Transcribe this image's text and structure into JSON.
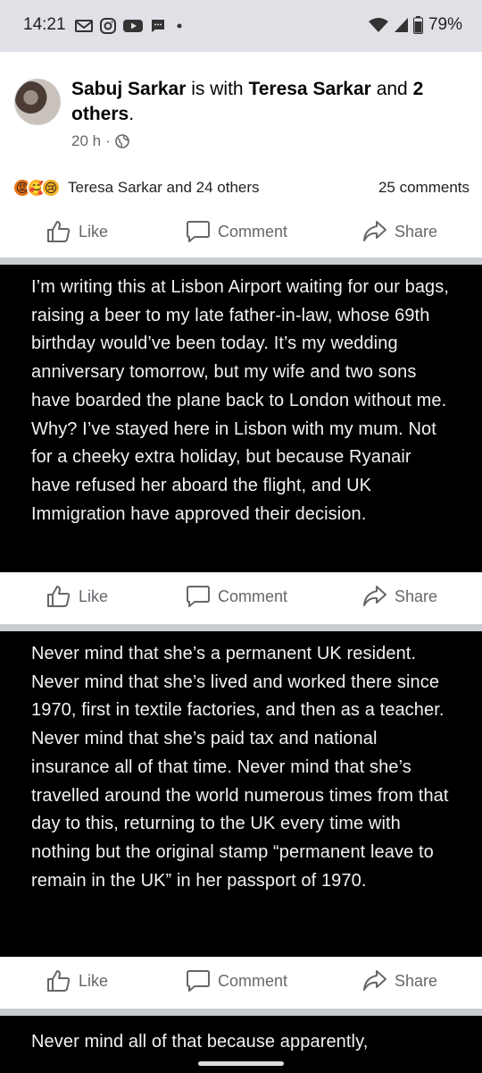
{
  "status_bar": {
    "time": "14:21",
    "left_icons": [
      "gmail-icon",
      "instagram-icon",
      "youtube-icon",
      "message-icon",
      "dot-icon"
    ],
    "battery": "79%"
  },
  "post": {
    "author": "Sabuj Sarkar",
    "with_text": "is with",
    "tagged": "Teresa Sarkar",
    "and_text": "and",
    "others": "2 others",
    "period": ".",
    "time": "20 h",
    "separator": "·",
    "reactions_text": "Teresa Sarkar and 24 others",
    "comments_text": "25 comments"
  },
  "actions": {
    "like": "Like",
    "comment": "Comment",
    "share": "Share"
  },
  "blocks": [
    {
      "text": "I’m writing this at Lisbon Airport waiting for our bags, raising a beer to my late father-in-law, whose 69th birthday would’ve been today. It’s my wedding anniversary tomorrow, but my wife and two sons have boarded the plane back to London without me. Why? I’ve stayed here in Lisbon with my mum. Not for a cheeky extra holiday, but because Ryanair have refused her aboard the flight, and UK Immigration have approved their decision."
    },
    {
      "text": "Never mind that she’s a permanent UK resident. Never mind that she’s lived and worked there since 1970, first in textile factories, and then as a teacher. Never mind that she’s paid tax and national insurance all of that time. Never mind that she’s travelled around the world numerous times from that day to this, returning to the UK every time with nothing but the original stamp “permanent leave to remain in the UK” in her passport of 1970."
    },
    {
      "text": "Never mind all of that because apparently,"
    }
  ],
  "colors": {
    "text_block_bg": "#000000",
    "muted": "#65676b",
    "status_bg": "#dfe1e6"
  }
}
